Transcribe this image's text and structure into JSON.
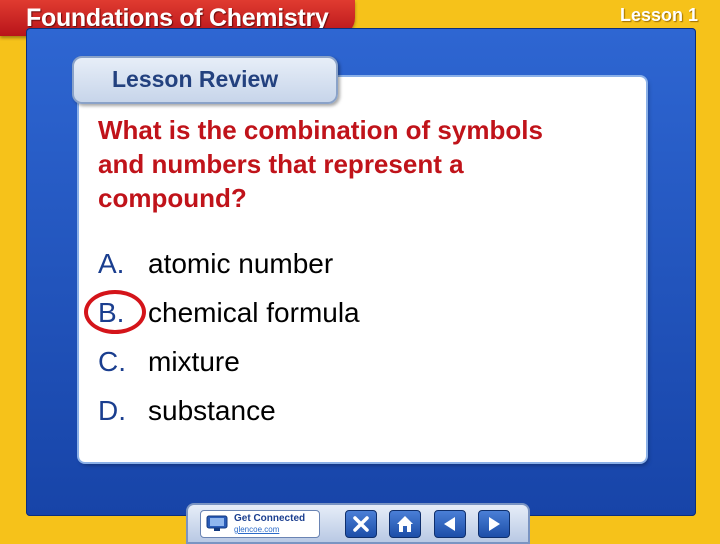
{
  "header": {
    "title": "Foundations of Chemistry",
    "lesson": "Lesson 1"
  },
  "review": {
    "tab_label": "Lesson Review",
    "question": "What is the combination of symbols and numbers that represent a compound?",
    "answers": [
      {
        "letter": "A.",
        "text": "atomic number",
        "selected": false
      },
      {
        "letter": "B.",
        "text": "chemical formula",
        "selected": true
      },
      {
        "letter": "C.",
        "text": "mixture",
        "selected": false
      },
      {
        "letter": "D.",
        "text": "substance",
        "selected": false
      }
    ]
  },
  "nav": {
    "get_connected_label": "Get Connected",
    "get_connected_sub": "glencoe.com",
    "buttons": [
      "close-icon",
      "home-icon",
      "previous-icon",
      "next-icon"
    ]
  },
  "colors": {
    "frame": "#f6c21a",
    "banner": "#c41d22",
    "panel": "#1e52bd",
    "question": "#c0131a",
    "answer_letter": "#1a3e8f",
    "selection_ring": "#d4141a"
  }
}
